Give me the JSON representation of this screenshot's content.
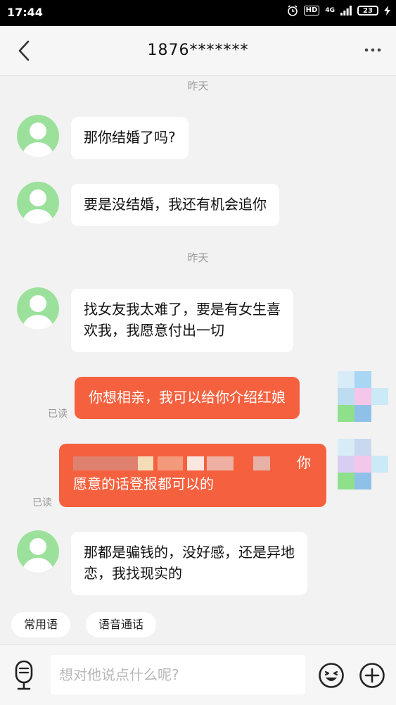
{
  "status_bar": {
    "time": "17:44",
    "hd": "HD",
    "network": "4G",
    "battery": "23"
  },
  "header": {
    "title": "1876*******"
  },
  "divider_1": "昨天",
  "divider_2": "昨天",
  "messages": [
    {
      "from": "other",
      "text": "那你结婚了吗?"
    },
    {
      "from": "other",
      "text": "要是没结婚，我还有机会追你"
    },
    {
      "from": "other",
      "line1": "找女友我太难了，要是有女生喜",
      "line2": "欢我，我愿意付出一切"
    },
    {
      "from": "self",
      "text": "你想相亲，我可以给你介绍红娘",
      "status": "已读"
    },
    {
      "from": "self",
      "line1_tail": "你",
      "line2": "愿意的话登报都可以的",
      "status": "已读"
    },
    {
      "from": "other",
      "line1": "那都是骗钱的，没好感，还是异地",
      "line2": "恋，我找现实的"
    }
  ],
  "quick_replies": [
    "常用语",
    "语音通话"
  ],
  "input": {
    "placeholder": "想对他说点什么呢?"
  },
  "colors": {
    "outgoing_bubble": "#f5613f",
    "avatar": "#9be19b",
    "background": "#f2f2f2"
  },
  "icons": [
    "back-arrow-icon",
    "more-dots-icon",
    "microphone-icon",
    "emoji-icon",
    "plus-icon"
  ]
}
